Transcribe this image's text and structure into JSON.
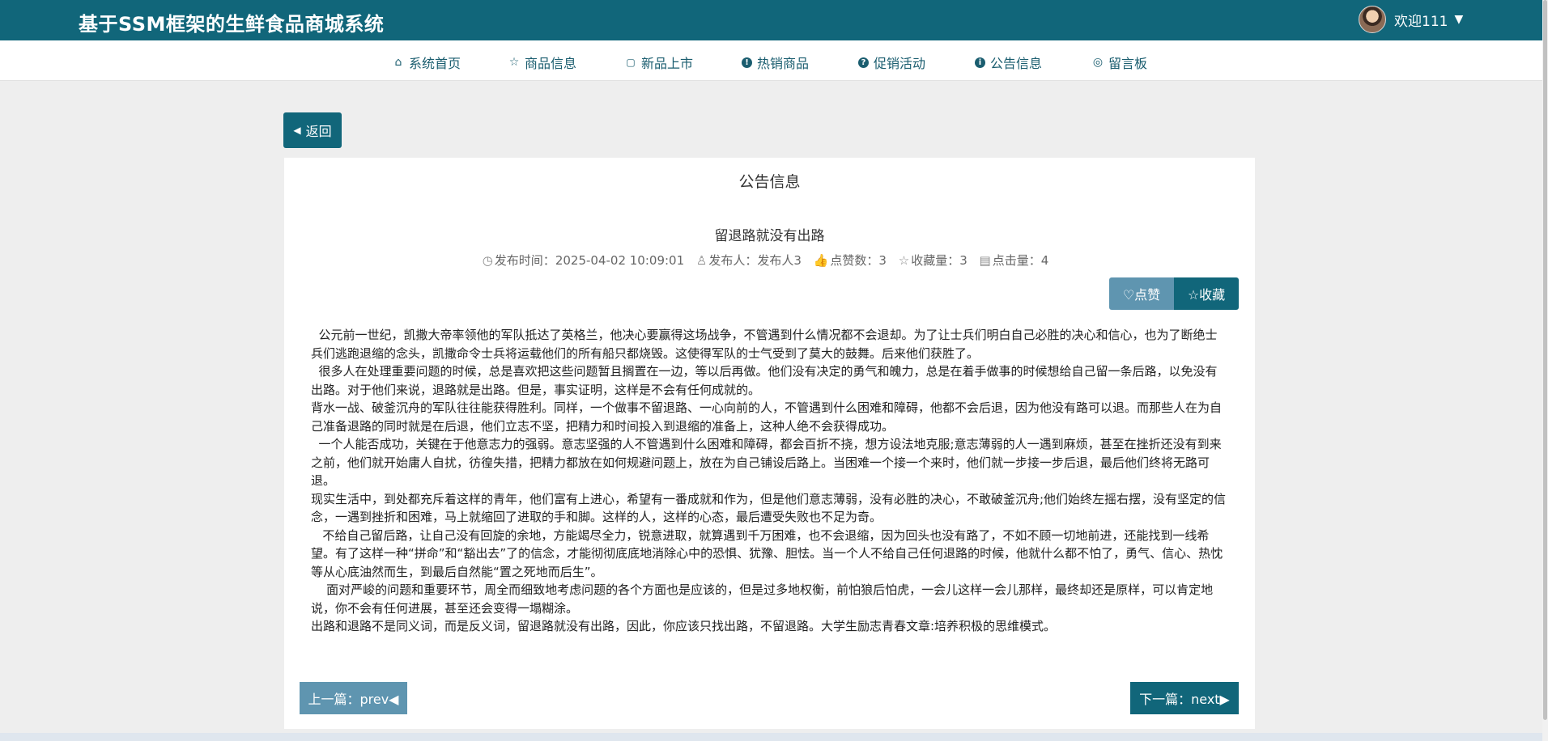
{
  "header": {
    "site_title": "基于SSM框架的生鲜食品商城系统",
    "welcome_text": "欢迎111",
    "caret_icon": "▼"
  },
  "nav": {
    "items": [
      {
        "label": "系统首页",
        "icon": "⌂"
      },
      {
        "label": "商品信息",
        "icon": "☆"
      },
      {
        "label": "新品上市",
        "icon": "🔒"
      },
      {
        "label": "热销商品",
        "icon": "!"
      },
      {
        "label": "促销活动",
        "icon": "?"
      },
      {
        "label": "公告信息",
        "icon": "i"
      },
      {
        "label": "留言板",
        "icon": "◎"
      }
    ]
  },
  "back_button": {
    "label": "返回",
    "icon": "◀"
  },
  "panel": {
    "heading": "公告信息"
  },
  "article": {
    "title": "留退路就没有出路",
    "meta": {
      "publish_time_label": "发布时间：",
      "publish_time": "2025-04-02 10:09:01",
      "publisher_label": "发布人：",
      "publisher": "发布人3",
      "likes_label": "点赞数：",
      "likes": "3",
      "favorites_label": "收藏量：",
      "favorites": "3",
      "clicks_label": "点击量：",
      "clicks": "4"
    },
    "actions": {
      "like_label": "♡点赞",
      "favorite_label": "☆收藏"
    },
    "paragraphs": [
      "  公元前一世纪，凯撒大帝率领他的军队抵达了英格兰，他决心要赢得这场战争，不管遇到什么情况都不会退却。为了让士兵们明白自己必胜的决心和信心，也为了断绝士兵们逃跑退缩的念头，凯撒命令士兵将运载他们的所有船只都烧毁。这使得军队的士气受到了莫大的鼓舞。后来他们获胜了。",
      "  很多人在处理重要问题的时候，总是喜欢把这些问题暂且搁置在一边，等以后再做。他们没有决定的勇气和魄力，总是在着手做事的时候想给自己留一条后路，以免没有出路。对于他们来说，退路就是出路。但是，事实证明，这样是不会有任何成就的。",
      "背水一战、破釜沉舟的军队往往能获得胜利。同样，一个做事不留退路、一心向前的人，不管遇到什么困难和障碍，他都不会后退，因为他没有路可以退。而那些人在为自己准备退路的同时就是在后退，他们立志不坚，把精力和时间投入到退缩的准备上，这种人绝不会获得成功。",
      "  一个人能否成功，关键在于他意志力的强弱。意志坚强的人不管遇到什么困难和障碍，都会百折不挠，想方设法地克服;意志薄弱的人一遇到麻烦，甚至在挫折还没有到来之前，他们就开始庸人自扰，彷徨失措，把精力都放在如何规避问题上，放在为自己铺设后路上。当困难一个接一个来时，他们就一步接一步后退，最后他们终将无路可退。",
      "现实生活中，到处都充斥着这样的青年，他们富有上进心，希望有一番成就和作为，但是他们意志薄弱，没有必胜的决心，不敢破釜沉舟;他们始终左摇右摆，没有坚定的信念，一遇到挫折和困难，马上就缩回了进取的手和脚。这样的人，这样的心态，最后遭受失败也不足为奇。",
      "   不给自己留后路，让自己没有回旋的余地，方能竭尽全力，锐意进取，就算遇到千万困难，也不会退缩，因为回头也没有路了，不如不顾一切地前进，还能找到一线希望。有了这样一种“拼命”和“豁出去”了的信念，才能彻彻底底地消除心中的恐惧、犹豫、胆怯。当一个人不给自己任何退路的时候，他就什么都不怕了，勇气、信心、热忱等从心底油然而生，到最后自然能“置之死地而后生”。",
      "    面对严峻的问题和重要环节，周全而细致地考虑问题的各个方面也是应该的，但是过多地权衡，前怕狼后怕虎，一会儿这样一会儿那样，最终却还是原样，可以肯定地说，你不会有任何进展，甚至还会变得一塌糊涂。",
      "出路和退路不是同义词，而是反义词，留退路就没有出路，因此，你应该只找出路，不留退路。大学生励志青春文章:培养积极的思维模式。"
    ],
    "prev_label": "上一篇：prev◀",
    "next_label": "下一篇：next▶"
  }
}
